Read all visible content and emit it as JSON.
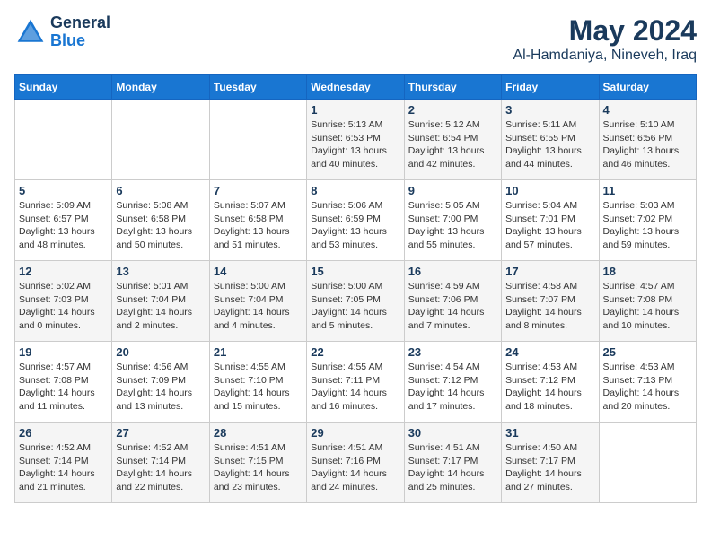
{
  "header": {
    "logo_line1": "General",
    "logo_line2": "Blue",
    "month": "May 2024",
    "location": "Al-Hamdaniya, Nineveh, Iraq"
  },
  "days_of_week": [
    "Sunday",
    "Monday",
    "Tuesday",
    "Wednesday",
    "Thursday",
    "Friday",
    "Saturday"
  ],
  "weeks": [
    [
      {
        "day": "",
        "detail": ""
      },
      {
        "day": "",
        "detail": ""
      },
      {
        "day": "",
        "detail": ""
      },
      {
        "day": "1",
        "detail": "Sunrise: 5:13 AM\nSunset: 6:53 PM\nDaylight: 13 hours\nand 40 minutes."
      },
      {
        "day": "2",
        "detail": "Sunrise: 5:12 AM\nSunset: 6:54 PM\nDaylight: 13 hours\nand 42 minutes."
      },
      {
        "day": "3",
        "detail": "Sunrise: 5:11 AM\nSunset: 6:55 PM\nDaylight: 13 hours\nand 44 minutes."
      },
      {
        "day": "4",
        "detail": "Sunrise: 5:10 AM\nSunset: 6:56 PM\nDaylight: 13 hours\nand 46 minutes."
      }
    ],
    [
      {
        "day": "5",
        "detail": "Sunrise: 5:09 AM\nSunset: 6:57 PM\nDaylight: 13 hours\nand 48 minutes."
      },
      {
        "day": "6",
        "detail": "Sunrise: 5:08 AM\nSunset: 6:58 PM\nDaylight: 13 hours\nand 50 minutes."
      },
      {
        "day": "7",
        "detail": "Sunrise: 5:07 AM\nSunset: 6:58 PM\nDaylight: 13 hours\nand 51 minutes."
      },
      {
        "day": "8",
        "detail": "Sunrise: 5:06 AM\nSunset: 6:59 PM\nDaylight: 13 hours\nand 53 minutes."
      },
      {
        "day": "9",
        "detail": "Sunrise: 5:05 AM\nSunset: 7:00 PM\nDaylight: 13 hours\nand 55 minutes."
      },
      {
        "day": "10",
        "detail": "Sunrise: 5:04 AM\nSunset: 7:01 PM\nDaylight: 13 hours\nand 57 minutes."
      },
      {
        "day": "11",
        "detail": "Sunrise: 5:03 AM\nSunset: 7:02 PM\nDaylight: 13 hours\nand 59 minutes."
      }
    ],
    [
      {
        "day": "12",
        "detail": "Sunrise: 5:02 AM\nSunset: 7:03 PM\nDaylight: 14 hours\nand 0 minutes."
      },
      {
        "day": "13",
        "detail": "Sunrise: 5:01 AM\nSunset: 7:04 PM\nDaylight: 14 hours\nand 2 minutes."
      },
      {
        "day": "14",
        "detail": "Sunrise: 5:00 AM\nSunset: 7:04 PM\nDaylight: 14 hours\nand 4 minutes."
      },
      {
        "day": "15",
        "detail": "Sunrise: 5:00 AM\nSunset: 7:05 PM\nDaylight: 14 hours\nand 5 minutes."
      },
      {
        "day": "16",
        "detail": "Sunrise: 4:59 AM\nSunset: 7:06 PM\nDaylight: 14 hours\nand 7 minutes."
      },
      {
        "day": "17",
        "detail": "Sunrise: 4:58 AM\nSunset: 7:07 PM\nDaylight: 14 hours\nand 8 minutes."
      },
      {
        "day": "18",
        "detail": "Sunrise: 4:57 AM\nSunset: 7:08 PM\nDaylight: 14 hours\nand 10 minutes."
      }
    ],
    [
      {
        "day": "19",
        "detail": "Sunrise: 4:57 AM\nSunset: 7:08 PM\nDaylight: 14 hours\nand 11 minutes."
      },
      {
        "day": "20",
        "detail": "Sunrise: 4:56 AM\nSunset: 7:09 PM\nDaylight: 14 hours\nand 13 minutes."
      },
      {
        "day": "21",
        "detail": "Sunrise: 4:55 AM\nSunset: 7:10 PM\nDaylight: 14 hours\nand 15 minutes."
      },
      {
        "day": "22",
        "detail": "Sunrise: 4:55 AM\nSunset: 7:11 PM\nDaylight: 14 hours\nand 16 minutes."
      },
      {
        "day": "23",
        "detail": "Sunrise: 4:54 AM\nSunset: 7:12 PM\nDaylight: 14 hours\nand 17 minutes."
      },
      {
        "day": "24",
        "detail": "Sunrise: 4:53 AM\nSunset: 7:12 PM\nDaylight: 14 hours\nand 18 minutes."
      },
      {
        "day": "25",
        "detail": "Sunrise: 4:53 AM\nSunset: 7:13 PM\nDaylight: 14 hours\nand 20 minutes."
      }
    ],
    [
      {
        "day": "26",
        "detail": "Sunrise: 4:52 AM\nSunset: 7:14 PM\nDaylight: 14 hours\nand 21 minutes."
      },
      {
        "day": "27",
        "detail": "Sunrise: 4:52 AM\nSunset: 7:14 PM\nDaylight: 14 hours\nand 22 minutes."
      },
      {
        "day": "28",
        "detail": "Sunrise: 4:51 AM\nSunset: 7:15 PM\nDaylight: 14 hours\nand 23 minutes."
      },
      {
        "day": "29",
        "detail": "Sunrise: 4:51 AM\nSunset: 7:16 PM\nDaylight: 14 hours\nand 24 minutes."
      },
      {
        "day": "30",
        "detail": "Sunrise: 4:51 AM\nSunset: 7:17 PM\nDaylight: 14 hours\nand 25 minutes."
      },
      {
        "day": "31",
        "detail": "Sunrise: 4:50 AM\nSunset: 7:17 PM\nDaylight: 14 hours\nand 27 minutes."
      },
      {
        "day": "",
        "detail": ""
      }
    ]
  ]
}
